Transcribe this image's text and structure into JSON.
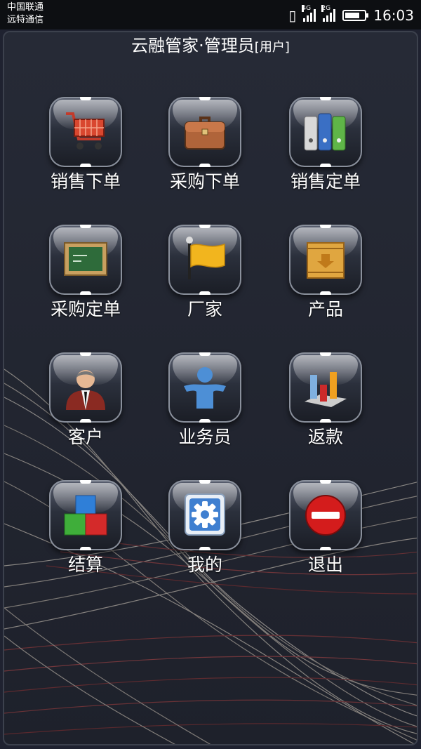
{
  "status_bar": {
    "carrier_1": "中国联通",
    "carrier_2": "远特通信",
    "net_1": "4G",
    "net_2": "2G",
    "time": "16:03",
    "battery_level": 0.8
  },
  "header": {
    "title": "云融管家·管理员",
    "role": "[用户]"
  },
  "menu": [
    {
      "label": "销售下单",
      "icon": "shopping-cart-icon"
    },
    {
      "label": "采购下单",
      "icon": "briefcase-icon"
    },
    {
      "label": "销售定单",
      "icon": "binders-icon"
    },
    {
      "label": "采购定单",
      "icon": "chalkboard-icon"
    },
    {
      "label": "厂家",
      "icon": "flag-icon"
    },
    {
      "label": "产品",
      "icon": "crate-icon"
    },
    {
      "label": "客户",
      "icon": "businessman-icon"
    },
    {
      "label": "业务员",
      "icon": "person-icon"
    },
    {
      "label": "返款",
      "icon": "bar-chart-icon"
    },
    {
      "label": "结算",
      "icon": "blocks-icon"
    },
    {
      "label": "我的",
      "icon": "gear-icon"
    },
    {
      "label": "退出",
      "icon": "no-entry-icon"
    }
  ],
  "colors": {
    "background": "#1f2230",
    "text": "#ffffff"
  }
}
